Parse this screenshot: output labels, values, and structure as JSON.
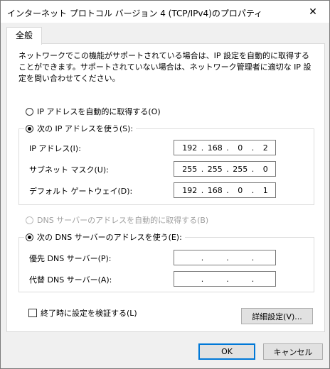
{
  "window": {
    "title": "インターネット プロトコル バージョン 4 (TCP/IPv4)のプロパティ"
  },
  "tab": {
    "label": "全般"
  },
  "description": "ネットワークでこの機能がサポートされている場合は、IP 設定を自動的に取得することができます。サポートされていない場合は、ネットワーク管理者に適切な IP 設定を問い合わせてください。",
  "ip": {
    "auto_label": "IP アドレスを自動的に取得する(O)",
    "manual_label": "次の IP アドレスを使う(S):",
    "selected": "manual",
    "fields": [
      {
        "label": "IP アドレス(I):",
        "octets": [
          "192",
          "168",
          "0",
          "2"
        ]
      },
      {
        "label": "サブネット マスク(U):",
        "octets": [
          "255",
          "255",
          "255",
          "0"
        ]
      },
      {
        "label": "デフォルト ゲートウェイ(D):",
        "octets": [
          "192",
          "168",
          "0",
          "1"
        ]
      }
    ]
  },
  "dns": {
    "auto_label": "DNS サーバーのアドレスを自動的に取得する(B)",
    "manual_label": "次の DNS サーバーのアドレスを使う(E):",
    "selected": "manual",
    "fields": [
      {
        "label": "優先 DNS サーバー(P):",
        "octets": [
          "",
          "",
          "",
          ""
        ]
      },
      {
        "label": "代替 DNS サーバー(A):",
        "octets": [
          "",
          "",
          "",
          ""
        ]
      }
    ]
  },
  "validate_label": "終了時に設定を検証する(L)",
  "validate_checked": false,
  "buttons": {
    "advanced": "詳細設定(V)...",
    "ok": "OK",
    "cancel": "キャンセル"
  },
  "ip_separator": "."
}
